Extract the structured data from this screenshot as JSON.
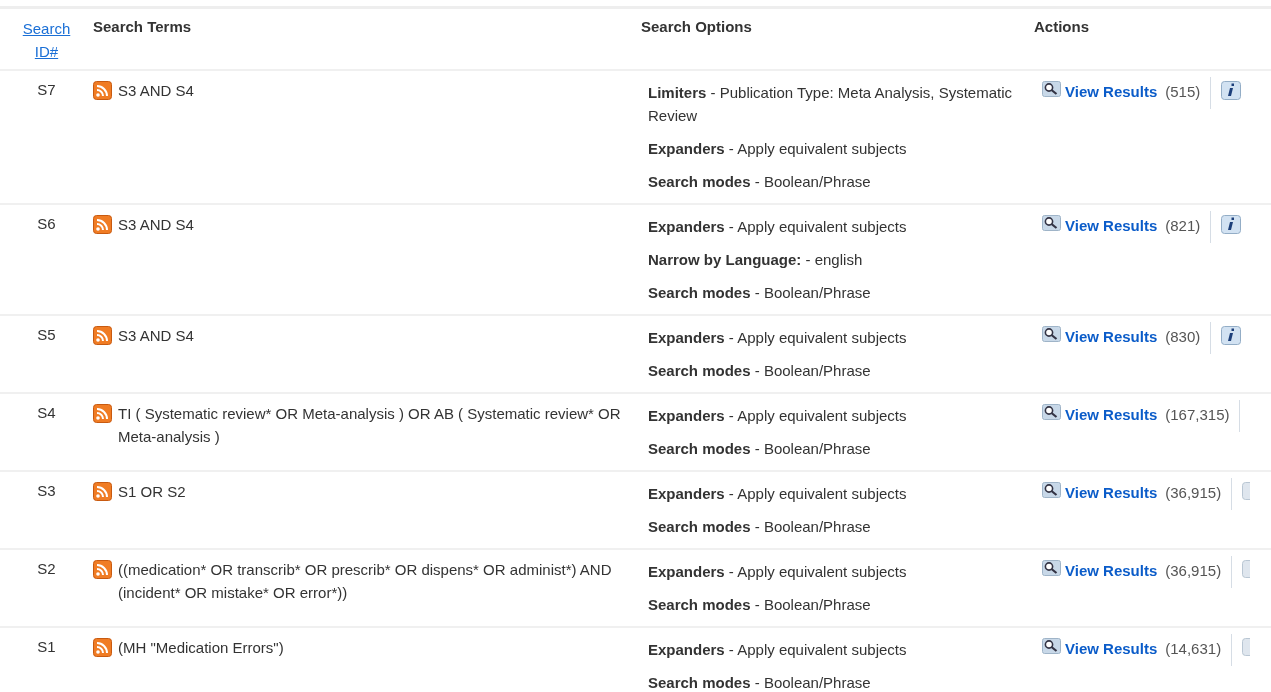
{
  "table": {
    "columns": [
      {
        "label": "Search ID#",
        "kind": "link"
      },
      {
        "label": "Search Terms",
        "kind": "bold"
      },
      {
        "label": "Search Options",
        "kind": "bold"
      },
      {
        "label": "Actions",
        "kind": "bold"
      }
    ],
    "rows": [
      {
        "id": "S7",
        "terms": "S3 AND S4",
        "options": [
          "**Limiters** - Publication Type: Meta Analysis, Systematic Review",
          "**Expanders** - Apply equivalent subjects",
          "**Search modes** - Boolean/Phrase"
        ],
        "action": "View Results",
        "count": "(515)",
        "trailing": {
          "kind": "info"
        }
      },
      {
        "id": "S6",
        "terms": "S3 AND S4",
        "options": [
          "**Expanders** - Apply equivalent subjects",
          "**Narrow by Language:** - english",
          "**Search modes** - Boolean/Phrase"
        ],
        "action": "View Results",
        "count": "(821)",
        "trailing": {
          "kind": "info"
        }
      },
      {
        "id": "S5",
        "terms": "S3 AND S4",
        "options": [
          "**Expanders** - Apply equivalent subjects",
          "**Search modes** - Boolean/Phrase"
        ],
        "action": "View Results",
        "count": "(830)",
        "trailing": {
          "kind": "info"
        }
      },
      {
        "id": "S4",
        "terms": "TI ( Systematic review* OR Meta-analysis ) OR AB ( Systematic review* OR Meta-analysis )",
        "options": [
          "**Expanders** - Apply equivalent subjects",
          "**Search modes** - Boolean/Phrase"
        ],
        "action": "View Results",
        "count": "(167,315)"
      },
      {
        "id": "S3",
        "terms": "S1 OR S2",
        "options": [
          "**Expanders** - Apply equivalent subjects",
          "**Search modes** - Boolean/Phrase"
        ],
        "action": "View Results",
        "count": "(36,915)",
        "trailing": {
          "kind": "cut"
        }
      },
      {
        "id": "S2",
        "terms": "((medication* OR transcrib* OR prescrib* OR dispens* OR administ*) AND (incident* OR mistake* OR error*))",
        "options": [
          "**Expanders** - Apply equivalent subjects",
          "**Search modes** - Boolean/Phrase"
        ],
        "action": "View Results",
        "count": "(36,915)",
        "trailing": {
          "kind": "cut"
        }
      },
      {
        "id": "S1",
        "terms": "(MH \"Medication Errors\")",
        "options": [
          "**Expanders** - Apply equivalent subjects",
          "**Search modes** - Boolean/Phrase"
        ],
        "action": "View Results",
        "count": "(14,631)",
        "trailing": {
          "kind": "cut"
        }
      }
    ]
  }
}
